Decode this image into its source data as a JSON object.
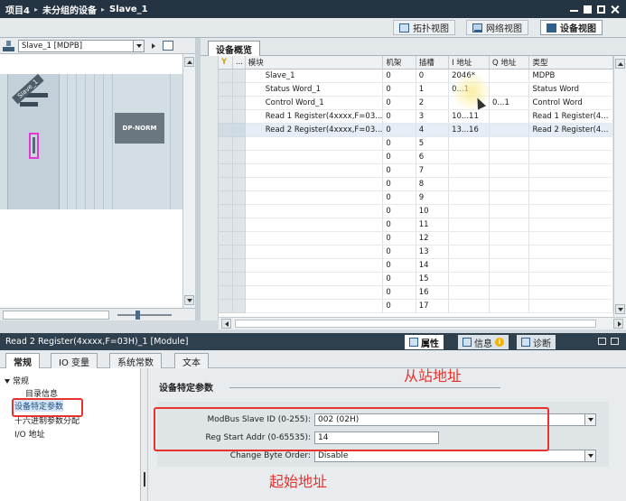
{
  "titlebar": {
    "crumbs": [
      "项目4",
      "未分组的设备",
      "Slave_1"
    ],
    "separator": "▸"
  },
  "view_tabs": {
    "topology": "拓扑视图",
    "network": "网络视图",
    "device": "设备视图"
  },
  "device_panel": {
    "selector_value": "Slave_1 [MDPB]",
    "slave_label": "Slave_1",
    "module_label": "DP-NORM"
  },
  "overview": {
    "tab_label": "设备概览",
    "columns": {
      "module": "模块",
      "rack": "机架",
      "slot": "插槽",
      "i_addr": "I 地址",
      "q_addr": "Q 地址",
      "type": "类型"
    },
    "rows": [
      {
        "module": "Slave_1",
        "rack": "0",
        "slot": "0",
        "i_addr": "2046*",
        "q_addr": "",
        "type": "MDPB"
      },
      {
        "module": "Status Word_1",
        "rack": "0",
        "slot": "1",
        "i_addr": "0...1",
        "q_addr": "",
        "type": "Status Word"
      },
      {
        "module": "Control Word_1",
        "rack": "0",
        "slot": "2",
        "i_addr": "",
        "q_addr": "0...1",
        "type": "Control Word"
      },
      {
        "module": "Read 1 Register(4xxxx,F=03...",
        "rack": "0",
        "slot": "3",
        "i_addr": "10...11",
        "q_addr": "",
        "type": "Read 1 Register(4..."
      },
      {
        "module": "Read 2 Register(4xxxx,F=03...",
        "rack": "0",
        "slot": "4",
        "i_addr": "13...16",
        "q_addr": "",
        "type": "Read 2 Register(4..."
      },
      {
        "module": "",
        "rack": "0",
        "slot": "5",
        "i_addr": "",
        "q_addr": "",
        "type": ""
      },
      {
        "module": "",
        "rack": "0",
        "slot": "6",
        "i_addr": "",
        "q_addr": "",
        "type": ""
      },
      {
        "module": "",
        "rack": "0",
        "slot": "7",
        "i_addr": "",
        "q_addr": "",
        "type": ""
      },
      {
        "module": "",
        "rack": "0",
        "slot": "8",
        "i_addr": "",
        "q_addr": "",
        "type": ""
      },
      {
        "module": "",
        "rack": "0",
        "slot": "9",
        "i_addr": "",
        "q_addr": "",
        "type": ""
      },
      {
        "module": "",
        "rack": "0",
        "slot": "10",
        "i_addr": "",
        "q_addr": "",
        "type": ""
      },
      {
        "module": "",
        "rack": "0",
        "slot": "11",
        "i_addr": "",
        "q_addr": "",
        "type": ""
      },
      {
        "module": "",
        "rack": "0",
        "slot": "12",
        "i_addr": "",
        "q_addr": "",
        "type": ""
      },
      {
        "module": "",
        "rack": "0",
        "slot": "13",
        "i_addr": "",
        "q_addr": "",
        "type": ""
      },
      {
        "module": "",
        "rack": "0",
        "slot": "14",
        "i_addr": "",
        "q_addr": "",
        "type": ""
      },
      {
        "module": "",
        "rack": "0",
        "slot": "15",
        "i_addr": "",
        "q_addr": "",
        "type": ""
      },
      {
        "module": "",
        "rack": "0",
        "slot": "16",
        "i_addr": "",
        "q_addr": "",
        "type": ""
      },
      {
        "module": "",
        "rack": "0",
        "slot": "17",
        "i_addr": "",
        "q_addr": "",
        "type": ""
      }
    ]
  },
  "inspector": {
    "title": "Read 2 Register(4xxxx,F=03H)_1 [Module]",
    "tabs": {
      "properties": "属性",
      "info": "信息",
      "diagnostics": "诊断"
    },
    "subtabs": [
      "常规",
      "IO 变量",
      "系统常数",
      "文本"
    ],
    "nav": {
      "general": "常规",
      "catalog": "目录信息",
      "device_params": "设备特定参数",
      "hex_params": "十六进制参数分配",
      "io_addr": "I/O 地址"
    },
    "section_title": "设备特定参数",
    "params": {
      "slave_id_label": "ModBus Slave ID (0-255):",
      "slave_id_value": "002 (02H)",
      "reg_start_label": "Reg Start Addr (0-65535):",
      "reg_start_value": "14",
      "byte_order_label": "Change Byte Order:",
      "byte_order_value": "Disable"
    }
  },
  "annotations": {
    "slave_addr": "从站地址",
    "start_addr": "起始地址",
    "color": "#e8322e"
  }
}
